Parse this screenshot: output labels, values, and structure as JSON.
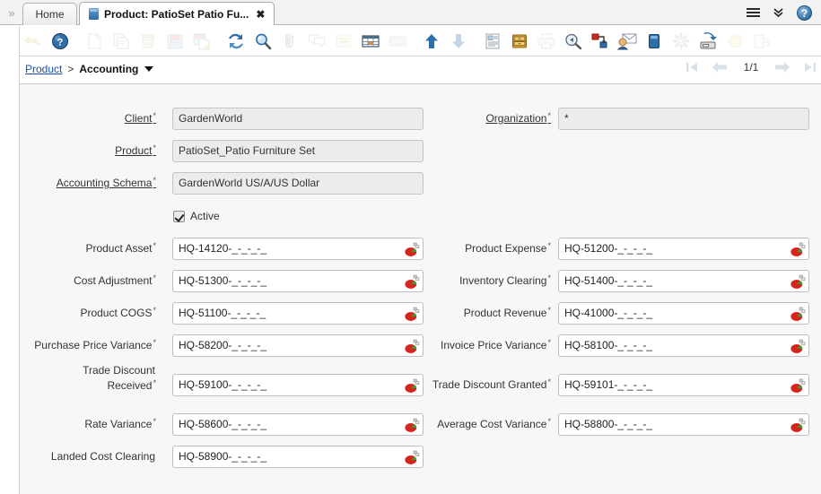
{
  "window": {
    "tabs": [
      {
        "label": "Home",
        "active": false,
        "icon": null
      },
      {
        "label": "Product: PatioSet Patio Fu...",
        "active": true,
        "icon": "product-doc-icon",
        "close": "✖"
      }
    ],
    "expand_icon": "»",
    "right_icons": [
      {
        "name": "menu-hamburger-icon"
      },
      {
        "name": "chevron-double-down-icon",
        "glyph": "ˇ"
      },
      {
        "name": "help-icon",
        "glyph": "?"
      }
    ]
  },
  "toolbar": {
    "buttons": [
      {
        "name": "undo-button",
        "title": "Undo",
        "enabled": false
      },
      {
        "name": "help-button",
        "title": "Help",
        "enabled": true
      },
      {
        "name": "new-record-button",
        "title": "New Record",
        "enabled": false
      },
      {
        "name": "copy-record-button",
        "title": "Copy Record",
        "enabled": false
      },
      {
        "name": "delete-record-button",
        "title": "Delete Record",
        "enabled": false
      },
      {
        "name": "save-button",
        "title": "Save Changes",
        "enabled": false
      },
      {
        "name": "save-create-button",
        "title": "Save and Create",
        "enabled": false
      },
      {
        "name": "refresh-button",
        "title": "Refresh",
        "enabled": true
      },
      {
        "name": "find-button",
        "title": "Find",
        "enabled": true
      },
      {
        "name": "attachment-button",
        "title": "Attachment",
        "enabled": false
      },
      {
        "name": "chat-button",
        "title": "Chat",
        "enabled": false
      },
      {
        "name": "postit-button",
        "title": "Post It Note",
        "enabled": false
      },
      {
        "name": "grid-toggle-button",
        "title": "Grid Toggle",
        "enabled": true
      },
      {
        "name": "multi-row-button",
        "title": "Multi Row Layout",
        "enabled": false
      },
      {
        "name": "parent-record-button",
        "title": "Parent Record",
        "enabled": true
      },
      {
        "name": "detail-record-button",
        "title": "Detail Record",
        "enabled": false
      },
      {
        "name": "report-button",
        "title": "Report",
        "enabled": true
      },
      {
        "name": "archive-button",
        "title": "Archive",
        "enabled": true
      },
      {
        "name": "print-button",
        "title": "Print",
        "enabled": false
      },
      {
        "name": "zoom-across-button",
        "title": "Zoom Across",
        "enabled": true
      },
      {
        "name": "active-workflow-button",
        "title": "Active Workflow",
        "enabled": true
      },
      {
        "name": "request-button",
        "title": "Requests",
        "enabled": true
      },
      {
        "name": "product-info-button",
        "title": "Product Info",
        "enabled": true
      },
      {
        "name": "preference-button",
        "title": "Preference",
        "enabled": false
      },
      {
        "name": "export-button",
        "title": "Export Data",
        "enabled": true
      },
      {
        "name": "attach-note-button",
        "title": "Attach Note",
        "enabled": false
      },
      {
        "name": "end-button",
        "title": "Exit",
        "enabled": false
      }
    ]
  },
  "breadcrumb": {
    "root": "Product",
    "separator": ">",
    "current": "Accounting"
  },
  "pager": {
    "first": "first-page",
    "prev": "previous-page",
    "position": "1/1",
    "next": "next-page",
    "last": "last-page"
  },
  "form": {
    "left": [
      {
        "label": "Client",
        "required": true,
        "underline": true,
        "value": "GardenWorld",
        "readonly": true,
        "account": false
      },
      {
        "label": "Product",
        "required": true,
        "underline": true,
        "value": "PatioSet_Patio Furniture Set",
        "readonly": true,
        "account": false
      },
      {
        "label": "Accounting Schema",
        "required": true,
        "underline": true,
        "value": "GardenWorld US/A/US Dollar",
        "readonly": true,
        "account": false
      },
      {
        "label": "Product Asset",
        "required": true,
        "underline": false,
        "value": "HQ-14120-_-_-_-_",
        "readonly": false,
        "account": true
      },
      {
        "label": "Cost Adjustment",
        "required": true,
        "underline": false,
        "value": "HQ-51300-_-_-_-_",
        "readonly": false,
        "account": true
      },
      {
        "label": "Product COGS",
        "required": true,
        "underline": false,
        "value": "HQ-51100-_-_-_-_",
        "readonly": false,
        "account": true
      },
      {
        "label": "Purchase Price Variance",
        "required": true,
        "underline": false,
        "value": "HQ-58200-_-_-_-_",
        "readonly": false,
        "account": true
      },
      {
        "label": "Trade Discount Received",
        "required": true,
        "underline": false,
        "value": "HQ-59100-_-_-_-_",
        "readonly": false,
        "account": true,
        "wrap": [
          "Trade Discount",
          "Received"
        ]
      },
      {
        "label": "Rate Variance",
        "required": true,
        "underline": false,
        "value": "HQ-58600-_-_-_-_",
        "readonly": false,
        "account": true
      },
      {
        "label": "Landed Cost Clearing",
        "required": false,
        "underline": false,
        "value": "HQ-58900-_-_-_-_",
        "readonly": false,
        "account": true
      }
    ],
    "right": [
      {
        "label": "Organization",
        "required": true,
        "underline": true,
        "value": "*",
        "readonly": true,
        "account": false
      },
      {
        "label": "Product Expense",
        "required": true,
        "underline": false,
        "value": "HQ-51200-_-_-_-_",
        "readonly": false,
        "account": true
      },
      {
        "label": "Inventory Clearing",
        "required": true,
        "underline": false,
        "value": "HQ-51400-_-_-_-_",
        "readonly": false,
        "account": true
      },
      {
        "label": "Product Revenue",
        "required": true,
        "underline": false,
        "value": "HQ-41000-_-_-_-_",
        "readonly": false,
        "account": true
      },
      {
        "label": "Invoice Price Variance",
        "required": true,
        "underline": false,
        "value": "HQ-58100-_-_-_-_",
        "readonly": false,
        "account": true
      },
      {
        "label": "Trade Discount Granted",
        "required": true,
        "underline": false,
        "value": "HQ-59101-_-_-_-_",
        "readonly": false,
        "account": true
      },
      {
        "label": "Average Cost Variance",
        "required": true,
        "underline": false,
        "value": "HQ-58800-_-_-_-_",
        "readonly": false,
        "account": true
      }
    ],
    "checkbox": {
      "label": "Active",
      "checked": true
    },
    "required_marker": "*",
    "account_button_name": "account-combination-picker"
  },
  "colors": {
    "accent_blue": "#2f6fa8",
    "link_blue": "#1a4fb0",
    "panel_bg": "#f7f7f7",
    "readonly_bg": "#ececec",
    "field_border": "#bdbdbd",
    "account_icon_red": "#d8241f"
  }
}
